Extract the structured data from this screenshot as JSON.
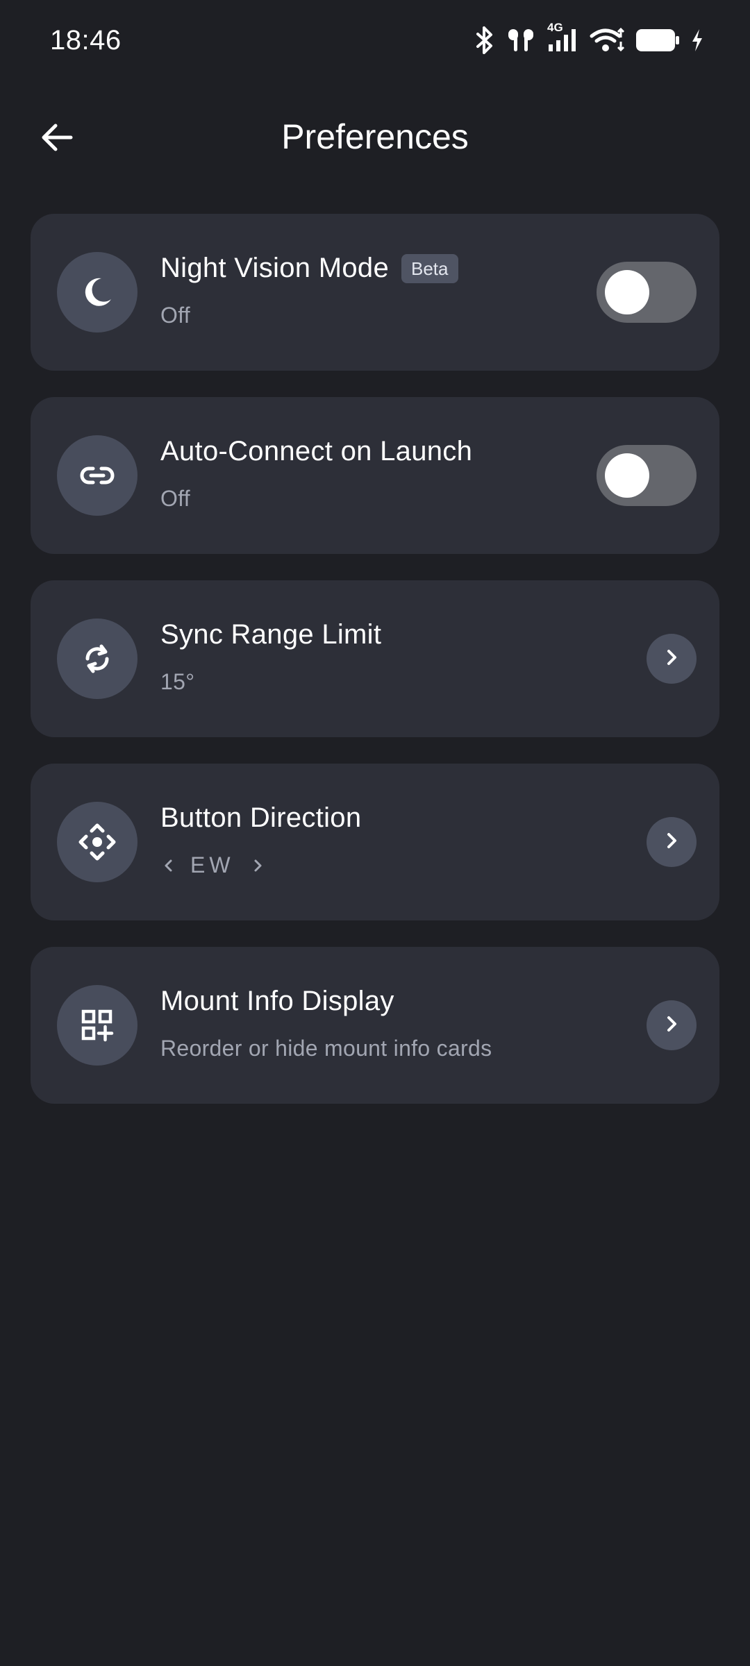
{
  "status_bar": {
    "time": "18:46",
    "network_label": "4G",
    "icons": [
      "bluetooth-icon",
      "earbuds-icon",
      "cellular-signal-icon",
      "wifi-icon",
      "battery-icon",
      "charging-icon"
    ]
  },
  "header": {
    "title": "Preferences",
    "back_icon": "arrow-left-icon"
  },
  "settings": [
    {
      "id": "night-vision",
      "title": "Night Vision Mode",
      "badge": "Beta",
      "subtitle": "Off",
      "icon": "moon-icon",
      "control": "toggle",
      "enabled": false
    },
    {
      "id": "auto-connect",
      "title": "Auto-Connect on Launch",
      "subtitle": "Off",
      "icon": "link-icon",
      "control": "toggle",
      "enabled": false
    },
    {
      "id": "sync-range",
      "title": "Sync Range Limit",
      "subtitle": "15°",
      "icon": "sync-icon",
      "control": "chevron"
    },
    {
      "id": "button-direction",
      "title": "Button Direction",
      "value": "EW",
      "icon": "direction-pad-icon",
      "control": "chevron"
    },
    {
      "id": "mount-info",
      "title": "Mount Info Display",
      "subtitle": "Reorder or hide mount info cards",
      "icon": "widgets-add-icon",
      "control": "chevron"
    }
  ],
  "colors": {
    "background": "#1e1f24",
    "card": "#2d2f38",
    "icon_circle": "#484d5c",
    "toggle_track_off": "#64666c",
    "subtitle_text": "#a2a6b2"
  }
}
